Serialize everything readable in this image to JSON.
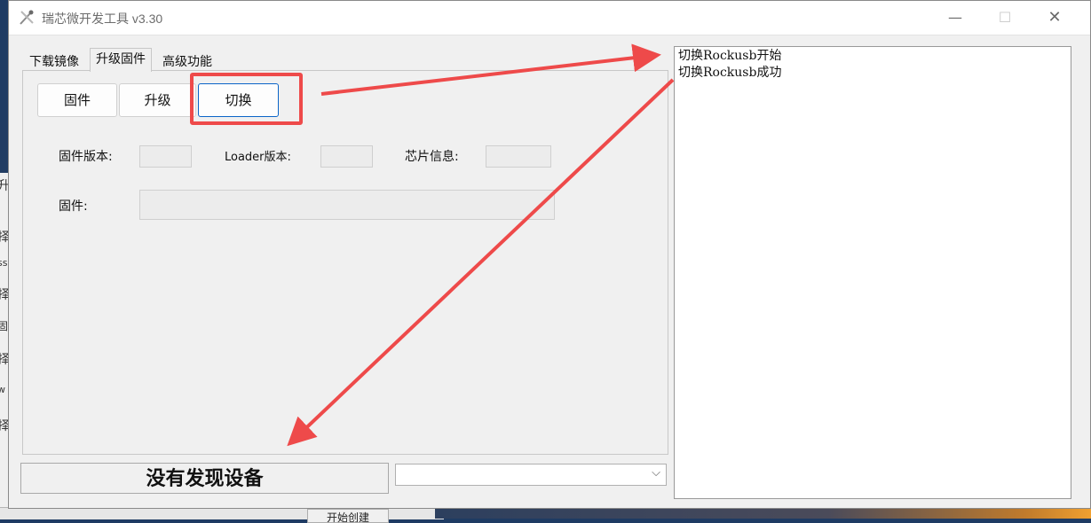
{
  "window": {
    "title": "瑞芯微开发工具 v3.30",
    "controls": {
      "minimize": "—",
      "maximize": "☐",
      "close": "✕"
    }
  },
  "tabs": [
    {
      "label": "下载镜像",
      "selected": false
    },
    {
      "label": "升级固件",
      "selected": true
    },
    {
      "label": "高级功能",
      "selected": false
    }
  ],
  "buttons": {
    "firmware": "固件",
    "upgrade": "升级",
    "switch": "切换"
  },
  "fields": {
    "firmware_version_label": "固件版本:",
    "firmware_version_value": "",
    "loader_version_label": "Loader版本:",
    "loader_version_value": "",
    "chip_info_label": "芯片信息:",
    "chip_info_value": "",
    "firmware_path_label": "固件:",
    "firmware_path_value": ""
  },
  "status": {
    "text": "没有发现设备",
    "device_select_value": ""
  },
  "log": {
    "lines": [
      "切换Rockusb开始",
      "切换Rockusb成功"
    ]
  },
  "background": {
    "left_glyphs": [
      "升",
      "择",
      "ss",
      "择",
      "固",
      "择",
      "w",
      "择"
    ],
    "bottom_button": "开始创建"
  },
  "colors": {
    "annotation": "#ee4a4a",
    "focus_border": "#0a64c8"
  }
}
